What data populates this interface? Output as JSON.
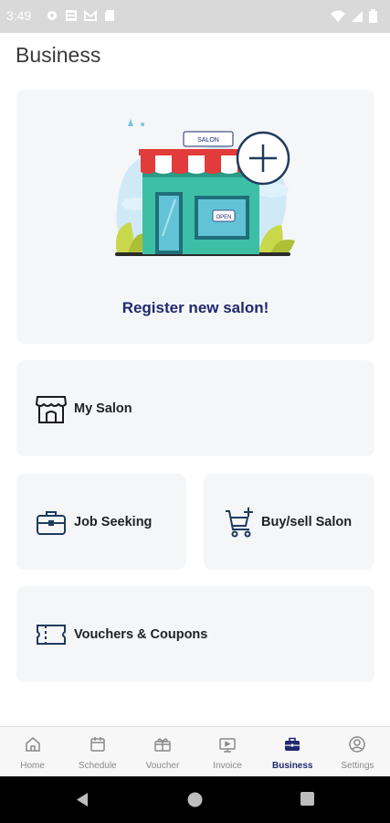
{
  "status_bar": {
    "time": "3:49"
  },
  "page": {
    "title": "Business"
  },
  "cards": {
    "register": {
      "label": "Register new salon!",
      "sign_text": "SALON",
      "open_text": "OPEN"
    },
    "my_salon": {
      "label": "My Salon"
    },
    "job_seeking": {
      "label": "Job Seeking"
    },
    "buy_sell": {
      "label": "Buy/sell Salon"
    },
    "vouchers": {
      "label": "Vouchers & Coupons"
    }
  },
  "bottom_nav": {
    "items": [
      {
        "label": "Home",
        "icon": "home-icon"
      },
      {
        "label": "Schedule",
        "icon": "calendar-icon"
      },
      {
        "label": "Voucher",
        "icon": "voucher-icon"
      },
      {
        "label": "Invoice",
        "icon": "invoice-icon"
      },
      {
        "label": "Business",
        "icon": "briefcase-icon",
        "active": true
      },
      {
        "label": "Settings",
        "icon": "settings-icon"
      }
    ],
    "active_color": "#1f2a6e",
    "inactive_color": "#8a8a8a"
  },
  "colors": {
    "accent": "#1f2a6e",
    "card_bg": "#f5f6f8"
  }
}
